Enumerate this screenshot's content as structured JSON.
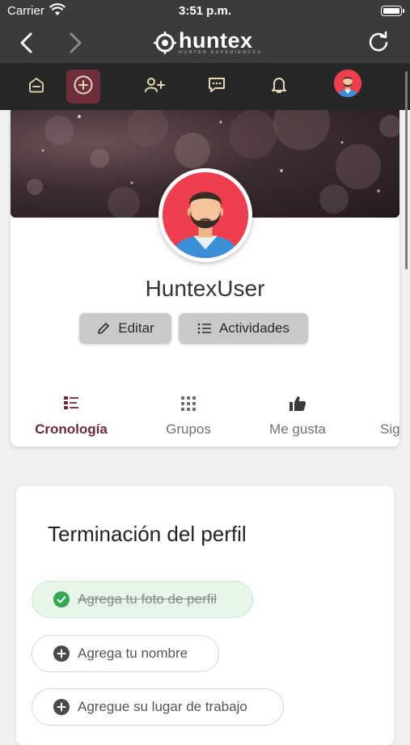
{
  "status_bar": {
    "carrier": "Carrier",
    "time": "3:51 p.m."
  },
  "navbar": {
    "brand": "huntex",
    "tagline": "HUNTER EXPERIENCES"
  },
  "tabbar": {
    "items": [
      "home-icon",
      "add-icon",
      "add-friend-icon",
      "messages-icon",
      "notifications-icon",
      "avatar"
    ]
  },
  "profile": {
    "username": "HuntexUser",
    "edit_label": "Editar",
    "activities_label": "Actividades",
    "tabs": [
      {
        "label": "Cronología",
        "icon": "timeline-icon",
        "active": true
      },
      {
        "label": "Grupos",
        "icon": "groups-icon",
        "active": false
      },
      {
        "label": "Me gusta",
        "icon": "thumbs-up-icon",
        "active": false
      },
      {
        "label": "Sig",
        "icon": "",
        "active": false
      }
    ]
  },
  "completion": {
    "title": "Terminación del perfil",
    "items": [
      {
        "label": "Agrega tu foto de perfil",
        "done": true
      },
      {
        "label": "Agrega tu nombre",
        "done": false
      },
      {
        "label": "Agregue su lugar de trabajo",
        "done": false
      }
    ]
  },
  "colors": {
    "accent": "#6b2a37",
    "header": "#3a3b3b",
    "tabbar": "#262727",
    "done_green": "#34a853"
  }
}
